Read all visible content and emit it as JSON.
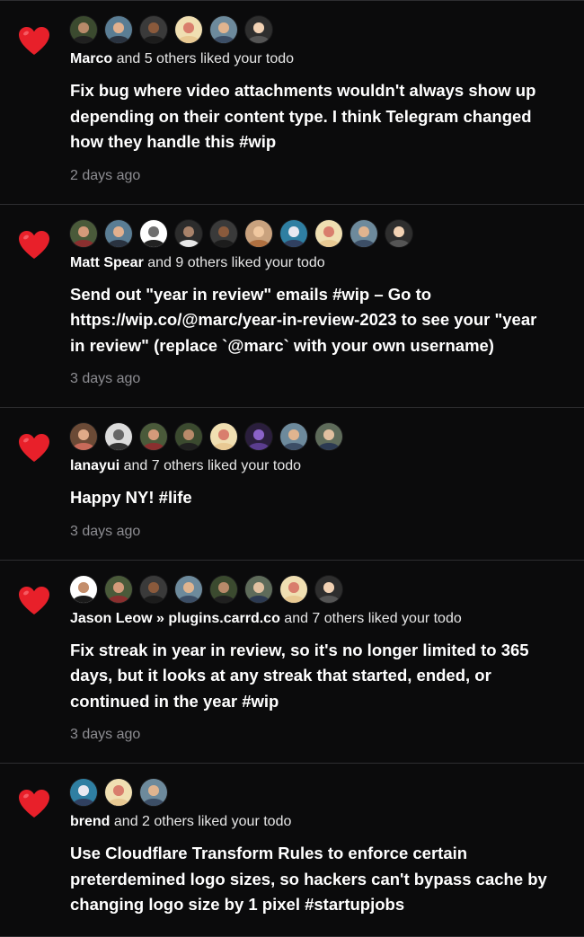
{
  "colors": {
    "background": "#0b0b0c",
    "divider": "#2e2e31",
    "heart": "#e8202a",
    "timestamp": "#8d8d92"
  },
  "icon": "red-heart-icon",
  "notifications": [
    {
      "who": "Marco",
      "suffix": " and 5 others liked your todo",
      "todo": "Fix bug where video attachments wouldn't always show up\ndepending on their content type. I think Telegram changed\nhow they handle this #wip",
      "time": "2 days ago",
      "avatars": [
        {
          "bg": "#3b4a2f",
          "face": "#b88a6a",
          "shirt": "#202020"
        },
        {
          "bg": "#5a7d94",
          "face": "#e2b08e",
          "shirt": "#2a3340"
        },
        {
          "bg": "#3a3a3a",
          "face": "#8a5a3c",
          "shirt": "#1c1c1c"
        },
        {
          "bg": "#f0dfb2",
          "face": "#d97e6d",
          "shirt": "#e8c993"
        },
        {
          "bg": "#6d8a9c",
          "face": "#e0b48f",
          "shirt": "#3c4e66"
        },
        {
          "bg": "#2e2e2e",
          "face": "#f2d2b4",
          "shirt": "#555"
        }
      ]
    },
    {
      "who": "Matt Spear",
      "suffix": " and 9 others liked your todo",
      "todo": "Send out \"year in review\" emails #wip – Go to\nhttps://wip.co/@marc/year-in-review-2023 to see your \"year\nin review\" (replace `@marc` with your own username)",
      "time": "3 days ago",
      "avatars": [
        {
          "bg": "#4a5a3a",
          "face": "#d49a7a",
          "shirt": "#8a2f2f"
        },
        {
          "bg": "#5a7d94",
          "face": "#e2b08e",
          "shirt": "#2a3340"
        },
        {
          "bg": "#ffffff",
          "face": "#6e6e6e",
          "shirt": "#222"
        },
        {
          "bg": "#2c2c2c",
          "face": "#a8826a",
          "shirt": "#e8e8e8"
        },
        {
          "bg": "#3a3a3a",
          "face": "#8a5a3c",
          "shirt": "#1c1c1c"
        },
        {
          "bg": "#c9a27e",
          "face": "#f0c8a0",
          "shirt": "#b07040"
        },
        {
          "bg": "#2f7fa2",
          "face": "#e8e8f0",
          "shirt": "#304060"
        },
        {
          "bg": "#f0dfb2",
          "face": "#d97e6d",
          "shirt": "#e8c993"
        },
        {
          "bg": "#6d8a9c",
          "face": "#e0b48f",
          "shirt": "#3c4e66"
        },
        {
          "bg": "#2e2e2e",
          "face": "#f2d2b4",
          "shirt": "#555"
        }
      ]
    },
    {
      "who": "lanayui",
      "suffix": " and 7 others liked your todo",
      "todo": "Happy NY! #life",
      "time": "3 days ago",
      "avatars": [
        {
          "bg": "#6b4a36",
          "face": "#e0aa88",
          "shirt": "#c86a5a"
        },
        {
          "bg": "#dcdcdc",
          "face": "#666",
          "shirt": "#333"
        },
        {
          "bg": "#4a5a3a",
          "face": "#d49a7a",
          "shirt": "#8a2f2f"
        },
        {
          "bg": "#3b4a2f",
          "face": "#b88a6a",
          "shirt": "#202020"
        },
        {
          "bg": "#f0dfb2",
          "face": "#d97e6d",
          "shirt": "#e8c993"
        },
        {
          "bg": "#2a1e3c",
          "face": "#8a62c8",
          "shirt": "#5b3d8f"
        },
        {
          "bg": "#6d8a9c",
          "face": "#e0b48f",
          "shirt": "#3c4e66"
        },
        {
          "bg": "#5e6b5a",
          "face": "#e2c0a0",
          "shirt": "#2c3a52"
        }
      ]
    },
    {
      "who": "Jason Leow » plugins.carrd.co",
      "suffix": " and 7 others liked your todo",
      "todo": "Fix streak in year in review, so it's no longer limited to 365\ndays, but it looks at any streak that started, ended, or\ncontinued in the year #wip",
      "time": "3 days ago",
      "avatars": [
        {
          "bg": "#ffffff",
          "face": "#c48e6c",
          "shirt": "#1a1a1a"
        },
        {
          "bg": "#4a5a3a",
          "face": "#d49a7a",
          "shirt": "#8a2f2f"
        },
        {
          "bg": "#3a3a3a",
          "face": "#8a5a3c",
          "shirt": "#1c1c1c"
        },
        {
          "bg": "#6d8a9c",
          "face": "#e0b48f",
          "shirt": "#3c4e66"
        },
        {
          "bg": "#3b4a2f",
          "face": "#b88a6a",
          "shirt": "#202020"
        },
        {
          "bg": "#5e6b5a",
          "face": "#e2c0a0",
          "shirt": "#2c3a52"
        },
        {
          "bg": "#f0dfb2",
          "face": "#d97e6d",
          "shirt": "#e8c993"
        },
        {
          "bg": "#2e2e2e",
          "face": "#f2d2b4",
          "shirt": "#555"
        }
      ]
    },
    {
      "who": "brend",
      "suffix": " and 2 others liked your todo",
      "todo": "Use Cloudflare Transform Rules to enforce certain\npreterdemined logo sizes, so hackers can't bypass cache by\nchanging logo size by 1 pixel #startupjobs",
      "time": "",
      "avatars": [
        {
          "bg": "#2f7fa2",
          "face": "#e8e8f0",
          "shirt": "#304060"
        },
        {
          "bg": "#f0dfb2",
          "face": "#d97e6d",
          "shirt": "#e8c993"
        },
        {
          "bg": "#6d8a9c",
          "face": "#e0b48f",
          "shirt": "#3c4e66"
        }
      ]
    }
  ]
}
